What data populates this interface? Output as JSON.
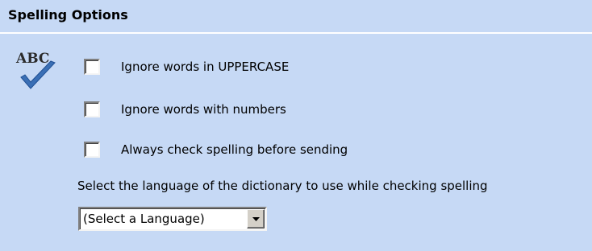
{
  "section": {
    "title": "Spelling Options"
  },
  "icon": {
    "name": "spellcheck-abc-icon",
    "text": "ABC",
    "check_color": "#3a6fb5"
  },
  "options": [
    {
      "label": "Ignore words in UPPERCASE",
      "checked": false
    },
    {
      "label": "Ignore words with numbers",
      "checked": false
    },
    {
      "label": "Always check spelling before sending",
      "checked": false
    }
  ],
  "language": {
    "prompt": "Select the language of the dictionary to use while checking spelling",
    "selected": "(Select a Language)"
  },
  "colors": {
    "panel_background": "#c6d9f5",
    "divider": "#ffffff"
  }
}
